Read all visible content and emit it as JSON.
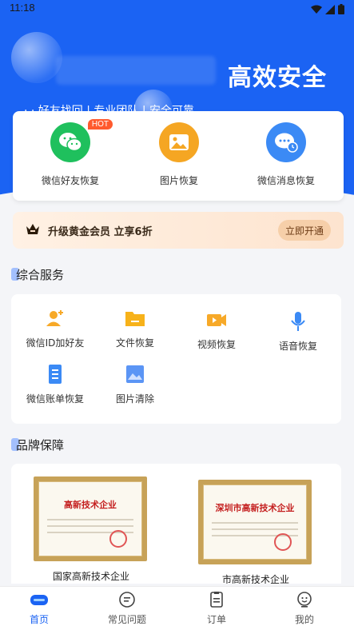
{
  "status_bar": {
    "time": "11:18"
  },
  "hero": {
    "slogan": "高效安全",
    "ticker": "· · 好友找回  |  专业团队  |  安全可靠"
  },
  "features": [
    {
      "label": "微信好友恢复",
      "icon": "wechat-icon",
      "badge": "HOT",
      "color": "#1fc05d"
    },
    {
      "label": "图片恢复",
      "icon": "image-icon",
      "color": "#f5a623"
    },
    {
      "label": "微信消息恢复",
      "icon": "chat-clock-icon",
      "color": "#3b8af5"
    }
  ],
  "vip": {
    "text": "升级黄金会员  立享6折",
    "button": "立即开通"
  },
  "services_section": {
    "title": "综合服务",
    "items": [
      {
        "label": "微信ID加好友",
        "icon": "add-user-icon"
      },
      {
        "label": "文件恢复",
        "icon": "folder-icon"
      },
      {
        "label": "视频恢复",
        "icon": "video-icon"
      },
      {
        "label": "语音恢复",
        "icon": "microphone-icon"
      },
      {
        "label": "微信账单恢复",
        "icon": "bill-icon"
      },
      {
        "label": "图片清除",
        "icon": "picture-icon"
      }
    ]
  },
  "brand_section": {
    "title": "品牌保障",
    "certificates": [
      {
        "label": "国家高新技术企业",
        "cert_title": "高新技术企业"
      },
      {
        "label": "市高新技术企业",
        "cert_title": "深圳市高新技术企业"
      }
    ]
  },
  "tabbar": {
    "items": [
      {
        "label": "首页",
        "icon": "home-icon",
        "active": true
      },
      {
        "label": "常见问题",
        "icon": "faq-icon",
        "active": false
      },
      {
        "label": "订单",
        "icon": "order-icon",
        "active": false
      },
      {
        "label": "我的",
        "icon": "profile-icon",
        "active": false
      }
    ]
  },
  "colors": {
    "primary": "#1b63f3",
    "hot": "#ff5a2e",
    "vip_button": "#f6cfa9"
  }
}
